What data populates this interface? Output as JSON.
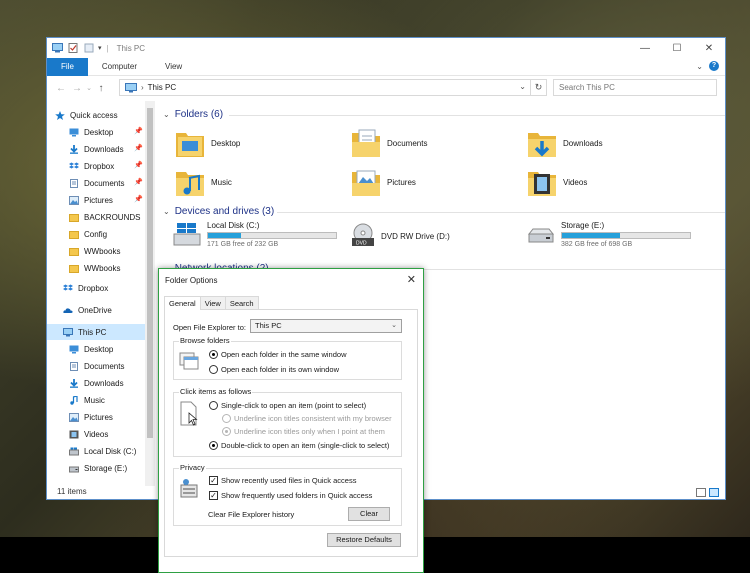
{
  "window": {
    "title": "This PC",
    "ribbon_tabs": [
      {
        "label": "File"
      },
      {
        "label": "Computer"
      },
      {
        "label": "View"
      }
    ]
  },
  "address": {
    "path": "This PC",
    "search_placeholder": "Search This PC"
  },
  "nav": {
    "quick_access": "Quick access",
    "quick_items": [
      {
        "label": "Desktop",
        "icon": "desktop-icon",
        "pinned": true
      },
      {
        "label": "Downloads",
        "icon": "downloads-icon",
        "pinned": true
      },
      {
        "label": "Dropbox",
        "icon": "dropbox-icon",
        "pinned": true
      },
      {
        "label": "Documents",
        "icon": "documents-icon",
        "pinned": true
      },
      {
        "label": "Pictures",
        "icon": "pictures-icon",
        "pinned": true
      },
      {
        "label": "BACKROUNDS",
        "icon": "folder-icon",
        "pinned": false
      },
      {
        "label": "Config",
        "icon": "folder-icon",
        "pinned": false
      },
      {
        "label": "WWbooks",
        "icon": "folder-icon",
        "pinned": false
      },
      {
        "label": "WWbooks",
        "icon": "folder-icon",
        "pinned": false
      }
    ],
    "dropbox": "Dropbox",
    "onedrive": "OneDrive",
    "this_pc": "This PC",
    "pc_items": [
      {
        "label": "Desktop",
        "icon": "desktop-icon"
      },
      {
        "label": "Documents",
        "icon": "documents-icon"
      },
      {
        "label": "Downloads",
        "icon": "downloads-icon"
      },
      {
        "label": "Music",
        "icon": "music-icon"
      },
      {
        "label": "Pictures",
        "icon": "pictures-icon"
      },
      {
        "label": "Videos",
        "icon": "videos-icon"
      },
      {
        "label": "Local Disk (C:)",
        "icon": "drive-icon"
      },
      {
        "label": "Storage (E:)",
        "icon": "drive-icon"
      }
    ]
  },
  "content": {
    "folders_header": "Folders (6)",
    "folders": [
      {
        "label": "Desktop",
        "icon": "desktop-folder-icon"
      },
      {
        "label": "Documents",
        "icon": "documents-folder-icon"
      },
      {
        "label": "Downloads",
        "icon": "downloads-folder-icon"
      },
      {
        "label": "Music",
        "icon": "music-folder-icon"
      },
      {
        "label": "Pictures",
        "icon": "pictures-folder-icon"
      },
      {
        "label": "Videos",
        "icon": "videos-folder-icon"
      }
    ],
    "devices_header": "Devices and drives (3)",
    "drives": [
      {
        "name": "Local Disk (C:)",
        "free": "171 GB free of 232 GB",
        "used_fraction": 0.26,
        "icon": "windows-drive-icon"
      },
      {
        "name": "DVD RW Drive (D:)",
        "free": "",
        "used_fraction": null,
        "icon": "dvd-drive-icon"
      },
      {
        "name": "Storage (E:)",
        "free": "382 GB free of 698 GB",
        "used_fraction": 0.45,
        "icon": "hdd-icon"
      }
    ],
    "network_header": "Network locations (2)"
  },
  "status": {
    "items": "11 items"
  },
  "dialog": {
    "title": "Folder Options",
    "tabs": [
      {
        "label": "General"
      },
      {
        "label": "View"
      },
      {
        "label": "Search"
      }
    ],
    "open_label": "Open File Explorer to:",
    "open_value": "This PC",
    "browse": {
      "legend": "Browse folders",
      "opt_same": "Open each folder in the same window",
      "opt_own": "Open each folder in its own window"
    },
    "click": {
      "legend": "Click items as follows",
      "single": "Single-click to open an item (point to select)",
      "underline_consistent": "Underline icon titles consistent with my browser",
      "underline_point": "Underline icon titles only when I point at them",
      "double": "Double-click to open an item (single-click to select)"
    },
    "privacy": {
      "legend": "Privacy",
      "recent": "Show recently used files in Quick access",
      "frequent": "Show frequently used folders in Quick access",
      "clear_label": "Clear File Explorer history",
      "clear_button": "Clear"
    },
    "restore_button": "Restore Defaults"
  }
}
